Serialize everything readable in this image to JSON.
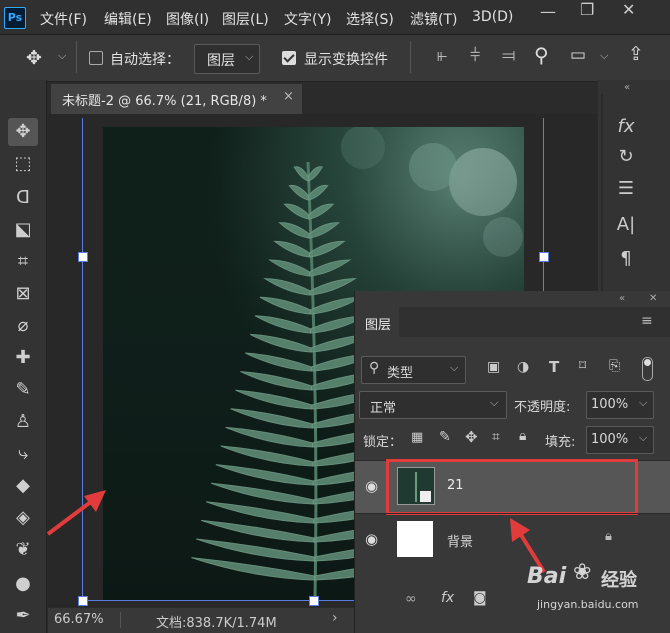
{
  "app": {
    "logo": "Ps"
  },
  "menu": [
    "文件(F)",
    "编辑(E)",
    "图像(I)",
    "图层(L)",
    "文字(Y)",
    "选择(S)",
    "滤镜(T)",
    "3D(D)"
  ],
  "options": {
    "auto_select_label": "自动选择：",
    "auto_select_checked": false,
    "target_value": "图层",
    "show_transform_label": "显示变换控件",
    "show_transform_checked": true
  },
  "document_tab": {
    "title": "未标题-2 @ 66.7% (21, RGB/8) *",
    "close": "×"
  },
  "status": {
    "zoom": "66.67%",
    "doc_info": "文档:838.7K/1.74M"
  },
  "layers_panel": {
    "title": "图层",
    "filter_kind": "类型",
    "blend_mode": "正常",
    "opacity_label": "不透明度:",
    "opacity_value": "100%",
    "lock_label": "锁定：",
    "fill_label": "填充:",
    "fill_value": "100%",
    "layers": [
      {
        "name": "21",
        "visible": true,
        "selected": true,
        "smart_object": true
      },
      {
        "name": "背景",
        "visible": true,
        "selected": false,
        "locked": true
      }
    ]
  },
  "watermark": {
    "brand": "Bai",
    "brand2": "经验",
    "url": "jingyan.baidu.com"
  },
  "colors": {
    "annotation_red": "#e23b3b",
    "guide_blue": "#5b7fe0",
    "selected_layer": "#565656"
  }
}
